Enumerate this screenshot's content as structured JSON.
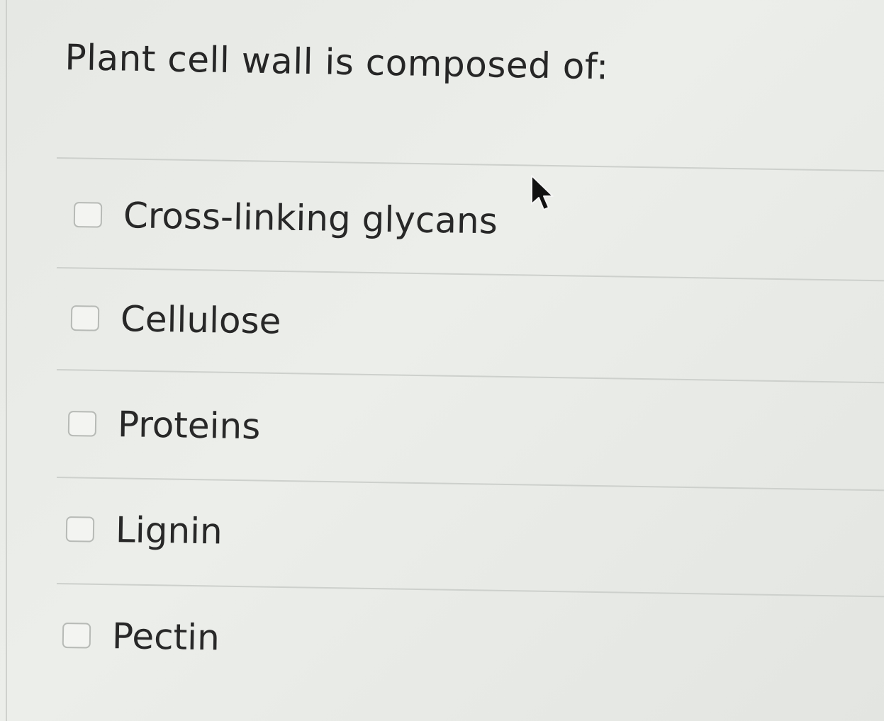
{
  "question": {
    "title": "Plant cell wall is composed of:",
    "input_type": "checkbox",
    "options": [
      {
        "label": "Cross-linking glycans",
        "checked": false
      },
      {
        "label": "Cellulose",
        "checked": false
      },
      {
        "label": "Proteins",
        "checked": false
      },
      {
        "label": "Lignin",
        "checked": false
      },
      {
        "label": "Pectin",
        "checked": false
      }
    ]
  },
  "colors": {
    "background": "#e8eae6",
    "text": "#282828",
    "divider": "#cdd0cc",
    "checkbox_border": "#b7bab6"
  },
  "icons": {
    "cursor": "arrow-pointer-icon"
  }
}
